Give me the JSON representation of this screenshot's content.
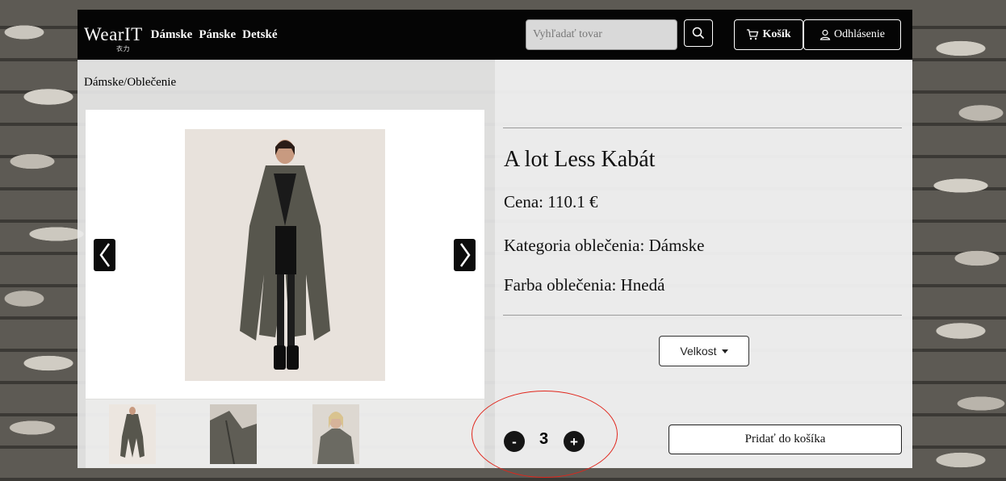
{
  "navbar": {
    "brand": "WearIT",
    "brand_sub": "衣力",
    "links": [
      "Dámske",
      "Pánske",
      "Detské"
    ],
    "search_placeholder": "Vyhľadať tovar",
    "search_icon": "search-icon",
    "cart_label": "Košík",
    "cart_icon": "cart-icon",
    "logout_label": "Odhlásenie",
    "user_icon": "user-icon"
  },
  "breadcrumb": "Dámske/Oblečenie",
  "product": {
    "title": "A lot Less Kabát",
    "price": "Cena: 110.1 €",
    "category": "Kategoria oblečenia: Dámske",
    "color": "Farba oblečenia: Hnedá"
  },
  "size_dropdown": {
    "label": "Velkost"
  },
  "quantity": {
    "minus": "-",
    "value": "3",
    "plus": "+"
  },
  "add_to_cart": "Pridať do košíka",
  "colors": {
    "navbar": "#050505",
    "annotation": "#e0251b"
  }
}
